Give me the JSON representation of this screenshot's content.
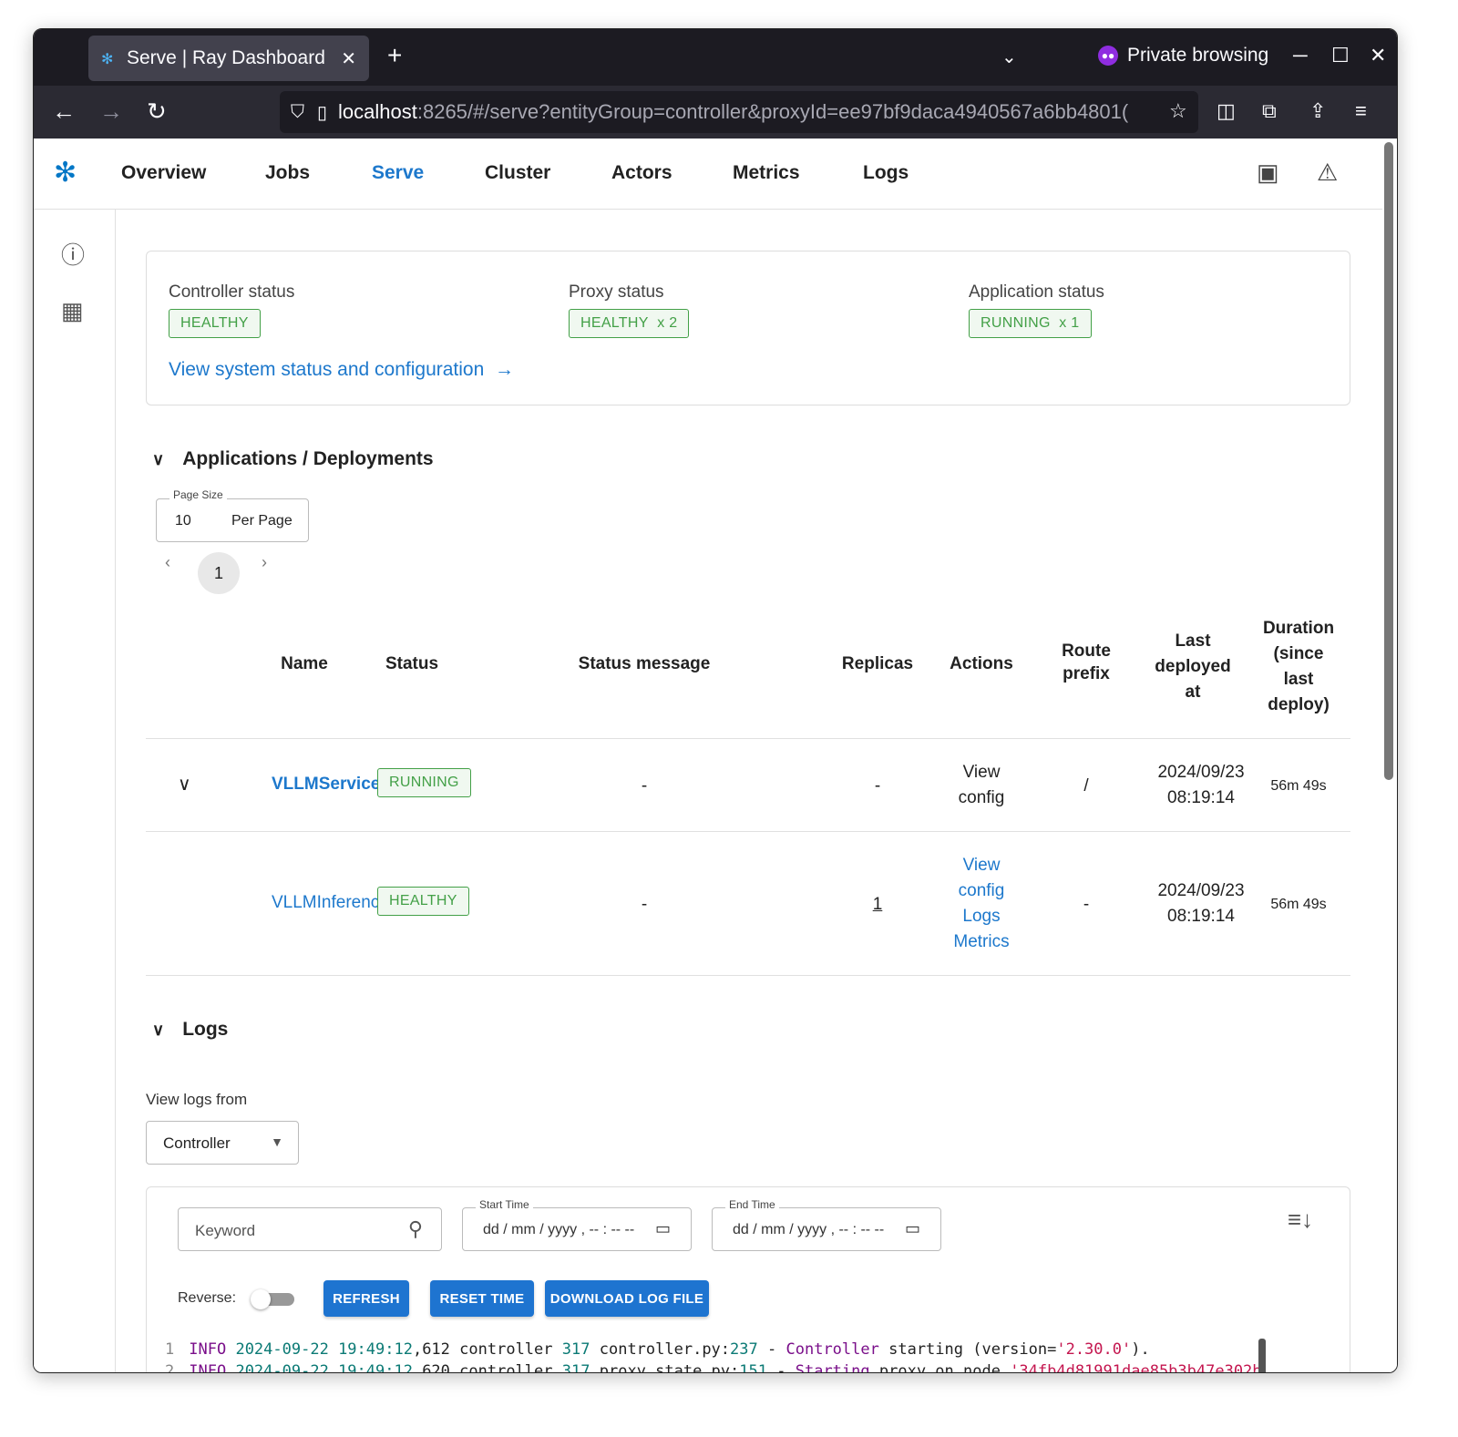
{
  "browser": {
    "tab_title": "Serve | Ray Dashboard",
    "private_label": "Private browsing",
    "url_host": "localhost",
    "url_path": ":8265/#/serve?entityGroup=controller&proxyId=ee97bf9daca4940567a6bb4801("
  },
  "nav": {
    "items": [
      "Overview",
      "Jobs",
      "Serve",
      "Cluster",
      "Actors",
      "Metrics",
      "Logs"
    ],
    "active": "Serve"
  },
  "status_card": {
    "controller_label": "Controller status",
    "controller_value": "HEALTHY",
    "proxy_label": "Proxy status",
    "proxy_value": "HEALTHY",
    "proxy_count": "x 2",
    "app_label": "Application status",
    "app_value": "RUNNING",
    "app_count": "x 1",
    "view_link": "View system status and configuration"
  },
  "applications": {
    "title": "Applications / Deployments",
    "page_size_label": "Page Size",
    "page_size_value": "10",
    "page_size_unit": "Per Page",
    "current_page": "1",
    "columns": {
      "name": "Name",
      "status": "Status",
      "status_message": "Status message",
      "replicas": "Replicas",
      "actions": "Actions",
      "route_prefix_1": "Route",
      "route_prefix_2": "prefix",
      "last_deployed_1": "Last",
      "last_deployed_2": "deployed",
      "last_deployed_3": "at",
      "duration_1": "Duration",
      "duration_2": "(since",
      "duration_3": "last",
      "duration_4": "deploy)"
    },
    "rows": [
      {
        "name": "VLLMService",
        "status": "RUNNING",
        "status_message": "-",
        "replicas": "-",
        "action_1": "View",
        "action_2": "config",
        "route_prefix": "/",
        "date": "2024/09/23",
        "time": "08:19:14",
        "duration": "56m 49s"
      },
      {
        "name": "VLLMInference",
        "status": "HEALTHY",
        "status_message": "-",
        "replicas": "1",
        "action_1": "View",
        "action_2": "config",
        "action_3": "Logs",
        "action_4": "Metrics",
        "route_prefix": "-",
        "date": "2024/09/23",
        "time": "08:19:14",
        "duration": "56m 49s"
      }
    ]
  },
  "logs": {
    "title": "Logs",
    "view_from_label": "View logs from",
    "view_from_value": "Controller",
    "keyword_placeholder": "Keyword",
    "start_time_label": "Start Time",
    "end_time_label": "End Time",
    "datetime_placeholder": "dd / mm / yyyy ,  -- : --   --",
    "reverse_label": "Reverse:",
    "refresh_button": "REFRESH",
    "reset_time_button": "RESET TIME",
    "download_button": "DOWNLOAD LOG FILE",
    "line1": {
      "num": "1",
      "level": "INFO",
      "date": "2024-09-22",
      "time": "19:49:12",
      "ms": ",612",
      "src": "controller",
      "pid": "317",
      "file": "controller.py:",
      "line": "237",
      "dash": "-",
      "kw": "Controller",
      "msg": "starting (version=",
      "version": "'2.30.0'",
      "end": ")."
    },
    "line2": {
      "num": "2",
      "level": "INFO",
      "date": "2024-09-22",
      "time": "19:49:12",
      "ms": ",620",
      "src": "controller",
      "pid": "317",
      "file": "proxy_state.py:",
      "line": "151",
      "dash": "-",
      "kw": "Starting",
      "msg": "proxy on node",
      "node": "'34fb4d81991dae85b3b47e302b"
    }
  }
}
